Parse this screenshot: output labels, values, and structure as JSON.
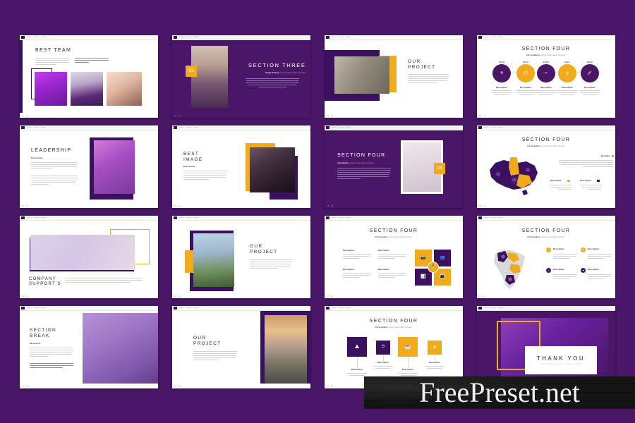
{
  "background_color": "#4a1667",
  "accent_colors": {
    "purple": "#3c1060",
    "deep_purple": "#4a1667",
    "gold": "#f0ab1d",
    "white": "#ffffff"
  },
  "watermark": {
    "text": "FreePreset.net"
  },
  "slides": [
    {
      "id": "best-team",
      "title": "BEST TEAM",
      "footer": "01 - 16",
      "photos": [
        "purple-portrait",
        "hat-portrait",
        "curly-portrait"
      ]
    },
    {
      "id": "section-three",
      "title": "SECTION THREE",
      "number": "03",
      "subtitle_bold": "Image Gallery,",
      "subtitle_thin": " lorem ipsum dolor sit amet",
      "footer": "02 - 16",
      "photos": [
        "lavender-portrait"
      ]
    },
    {
      "id": "our-project-1",
      "title": "OUR\nPROJECT",
      "footer": "03 - 16",
      "photos": [
        "stone-plant"
      ]
    },
    {
      "id": "section-four-timeline",
      "title": "SECTION FOUR",
      "subtitle_bold": "Info Graphics,",
      "subtitle_thin": " lorem ipsum dolor sit amet",
      "footer": "04 - 16",
      "timeline": [
        {
          "year": "2018",
          "icon": "flask-icon",
          "color": "#4a1667",
          "label": "Description"
        },
        {
          "year": "2019",
          "icon": "folder-icon",
          "color": "#f0ab1d",
          "label": "Description"
        },
        {
          "year": "2020",
          "icon": "network-icon",
          "color": "#4a1667",
          "label": "Description"
        },
        {
          "year": "2021",
          "icon": "globe-icon",
          "color": "#f0ab1d",
          "label": "Description"
        },
        {
          "year": "2022",
          "icon": "rocket-icon",
          "color": "#4a1667",
          "label": "Description"
        }
      ]
    },
    {
      "id": "leadership",
      "title": "LEADERSHIP",
      "subtitle_bold": "Description",
      "footer": "05 - 16",
      "photos": [
        "dancer-violet"
      ]
    },
    {
      "id": "best-image",
      "title": "BEST\nIMAGE",
      "subtitle_bold": "Description",
      "footer": "06 - 16",
      "photos": [
        "bloom-dark"
      ]
    },
    {
      "id": "section-four-cactus",
      "title": "SECTION FOUR",
      "number": "04",
      "subtitle_bold": "Infographics,",
      "subtitle_thin": " lorem ipsum dolor sit amet",
      "footer": "07 - 16",
      "photos": [
        "cactus"
      ]
    },
    {
      "id": "section-four-australia",
      "title": "SECTION FOUR",
      "subtitle_bold": "Info Graphics,",
      "subtitle_thin": " lorem ipsum dolor sit amet",
      "footer": "08 - 16",
      "map": "australia",
      "legend": [
        {
          "label": "Australia",
          "marker": "gold-square"
        },
        {
          "label": "Description",
          "marker": "gold-square"
        },
        {
          "label": "Description",
          "marker": "dark-square"
        }
      ]
    },
    {
      "id": "company-supports",
      "title": "COMPANY\nSUPPORT'S",
      "footer": "09 - 16",
      "photos": [
        "ballet-dancer"
      ]
    },
    {
      "id": "our-project-2",
      "title": "OUR\nPROJECT",
      "footer": "10 - 16",
      "photos": [
        "grass-field"
      ]
    },
    {
      "id": "section-four-quad",
      "title": "SECTION FOUR",
      "subtitle_bold": "Info Graphics,",
      "subtitle_thin": " lorem ipsum dolor sit amet",
      "footer": "11 - 16",
      "items": [
        {
          "label": "Description",
          "icon": "camera-icon",
          "color": "#f0ab1d"
        },
        {
          "label": "Description",
          "icon": "users-icon",
          "color": "#3c1060"
        },
        {
          "label": "Description",
          "icon": "chart-icon",
          "color": "#3c1060"
        },
        {
          "label": "Description",
          "icon": "people-icon",
          "color": "#f0ab1d"
        }
      ],
      "center_icon": "medal-icon"
    },
    {
      "id": "section-four-africa",
      "title": "SECTION FOUR",
      "subtitle_bold": "Info Graphics,",
      "subtitle_thin": " lorem ipsum dolor sit amet",
      "footer": "12 - 16",
      "map": "africa",
      "legend": [
        {
          "label": "Description",
          "marker": "gold-circle"
        },
        {
          "label": "Description",
          "marker": "gold-circle"
        },
        {
          "label": "Description",
          "marker": "dark-circle"
        },
        {
          "label": "Description",
          "marker": "dark-circle"
        }
      ]
    },
    {
      "id": "section-break",
      "title": "SECTION\nBREAK",
      "subtitle_bold": "Description",
      "footer": "13 - 16",
      "photos": [
        "knit-flowers"
      ]
    },
    {
      "id": "our-project-3",
      "title": "OUR\nPROJECT",
      "footer": "14 - 16",
      "photos": [
        "sunset-lavender"
      ]
    },
    {
      "id": "section-four-steps",
      "title": "SECTION FOUR",
      "subtitle_bold": "Info Graphics,",
      "subtitle_thin": " lorem ipsum dolor sit amet",
      "footer": "15 - 16",
      "steps": [
        {
          "label": "Description",
          "icon": "mountain-icon",
          "color": "#3c1060"
        },
        {
          "label": "Description",
          "icon": "clock-icon",
          "color": "#3c1060"
        },
        {
          "label": "Description",
          "icon": "cup-icon",
          "color": "#f0ab1d"
        },
        {
          "label": "Description",
          "icon": "gear-icon",
          "color": "#f0ab1d"
        }
      ]
    },
    {
      "id": "thank-you",
      "title": "THANK YOU",
      "subtitle_thin": "PRESENTATION TEMPLATE",
      "footer": "16 - 16",
      "photos": [
        "woman-purple"
      ]
    }
  ]
}
